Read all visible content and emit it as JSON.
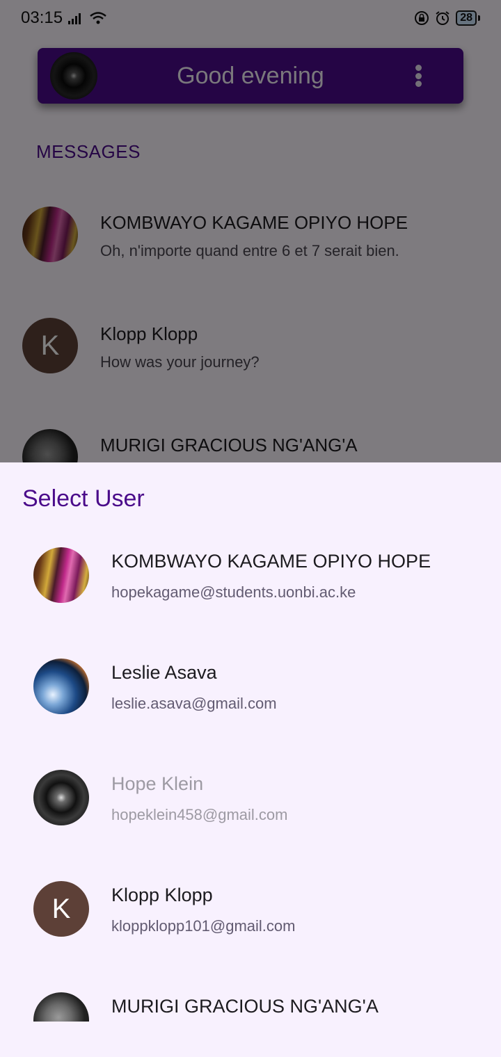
{
  "status_bar": {
    "time": "03:15",
    "battery": "28"
  },
  "app_bar": {
    "title": "Good evening"
  },
  "messages": {
    "header": "MESSAGES",
    "items": [
      {
        "name": "KOMBWAYO KAGAME OPIYO HOPE",
        "preview": "Oh, n'importe quand entre 6 et 7 serait bien."
      },
      {
        "name": "Klopp Klopp",
        "preview": "How was your journey?",
        "initial": "K"
      },
      {
        "name": "MURIGI GRACIOUS NG'ANG'A",
        "preview": ""
      }
    ]
  },
  "sheet": {
    "title": "Select User",
    "users": [
      {
        "name": "KOMBWAYO KAGAME OPIYO HOPE",
        "email": "hopekagame@students.uonbi.ac.ke"
      },
      {
        "name": "Leslie Asava",
        "email": "leslie.asava@gmail.com"
      },
      {
        "name": "Hope Klein",
        "email": "hopeklein458@gmail.com",
        "disabled": true
      },
      {
        "name": "Klopp Klopp",
        "email": "kloppklopp101@gmail.com",
        "initial": "K"
      },
      {
        "name": "MURIGI GRACIOUS NG'ANG'A",
        "email": ""
      }
    ]
  },
  "colors": {
    "primary": "#4a0a8a",
    "sheet_background": "#f8f1fe",
    "avatar_k": "#5d4037"
  }
}
